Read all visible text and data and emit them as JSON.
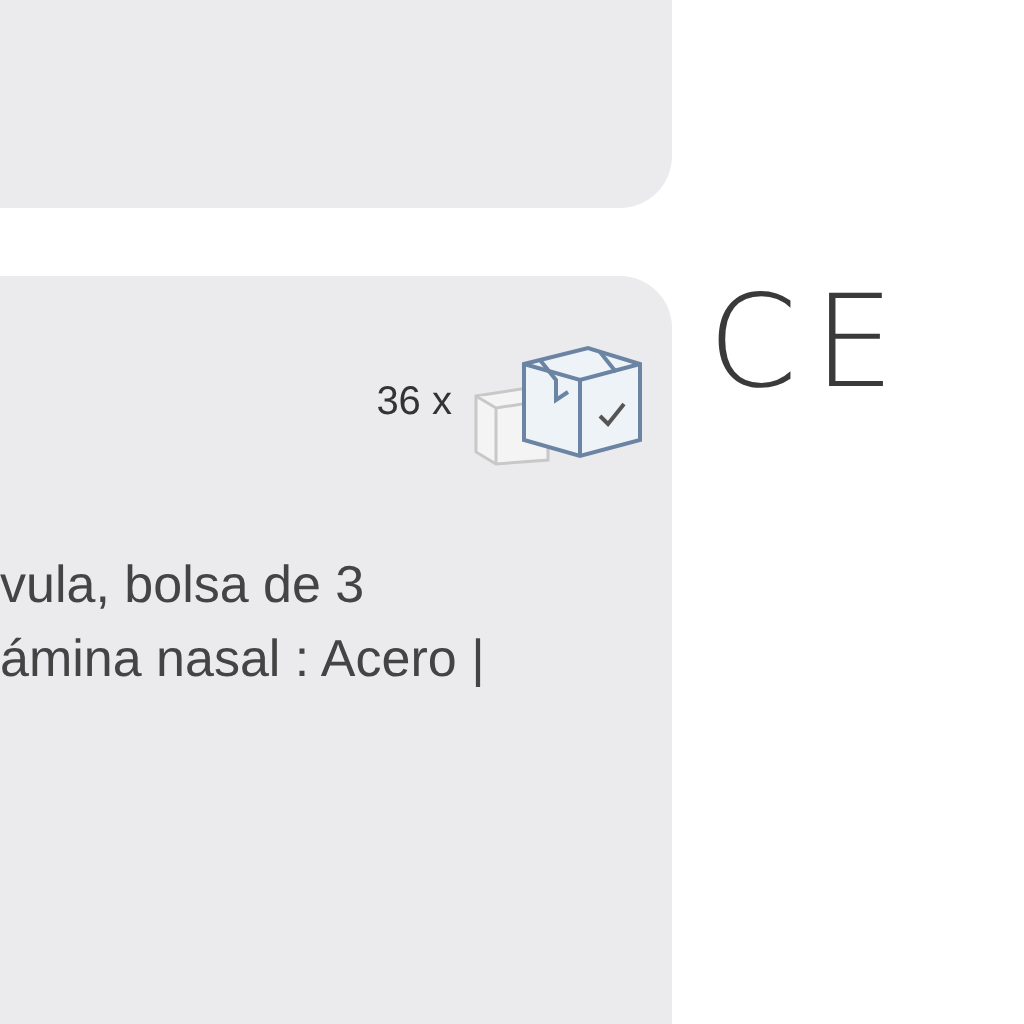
{
  "card": {
    "pack_quantity": "36 x",
    "description_lines": [
      "vula, bolsa de 3",
      "ámina nasal : Acero |"
    ]
  },
  "certification": {
    "mark": "CE"
  }
}
